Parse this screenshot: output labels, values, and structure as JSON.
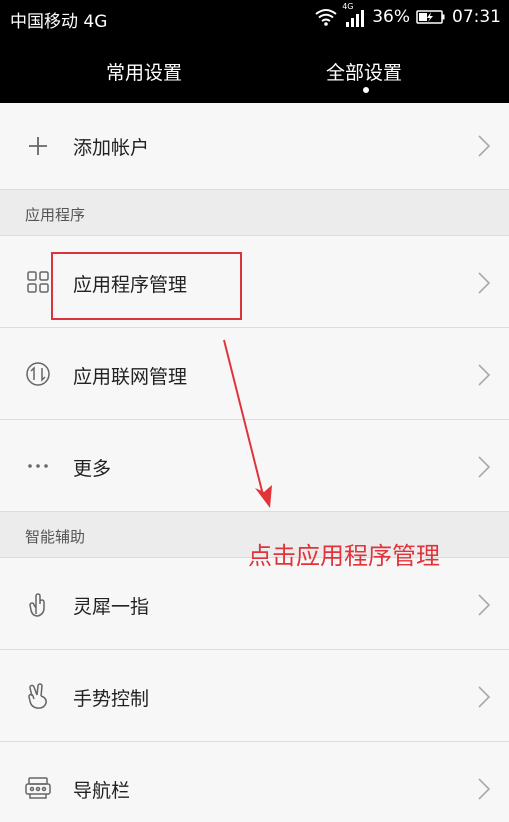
{
  "status_bar": {
    "carrier": "中国移动 4G",
    "network_tag": "4G",
    "battery": "36%",
    "time": "07:31"
  },
  "tabs": [
    {
      "label": "常用设置",
      "active": false
    },
    {
      "label": "全部设置",
      "active": true
    }
  ],
  "account": {
    "label": "添加帐户",
    "icon": "plus-icon"
  },
  "sections": [
    {
      "header": "应用程序",
      "items": [
        {
          "label": "应用程序管理",
          "icon": "grid-icon"
        },
        {
          "label": "应用联网管理",
          "icon": "network-icon"
        },
        {
          "label": "更多",
          "icon": "more-icon"
        }
      ]
    },
    {
      "header": "智能辅助",
      "items": [
        {
          "label": "灵犀一指",
          "icon": "finger-icon"
        },
        {
          "label": "手势控制",
          "icon": "gesture-icon"
        },
        {
          "label": "导航栏",
          "icon": "navbar-icon"
        }
      ]
    }
  ],
  "annotation": {
    "text": "点击应用程序管理",
    "color": "#e0343a"
  },
  "colors": {
    "highlight": "#d9343a",
    "status_bg": "#000000"
  }
}
